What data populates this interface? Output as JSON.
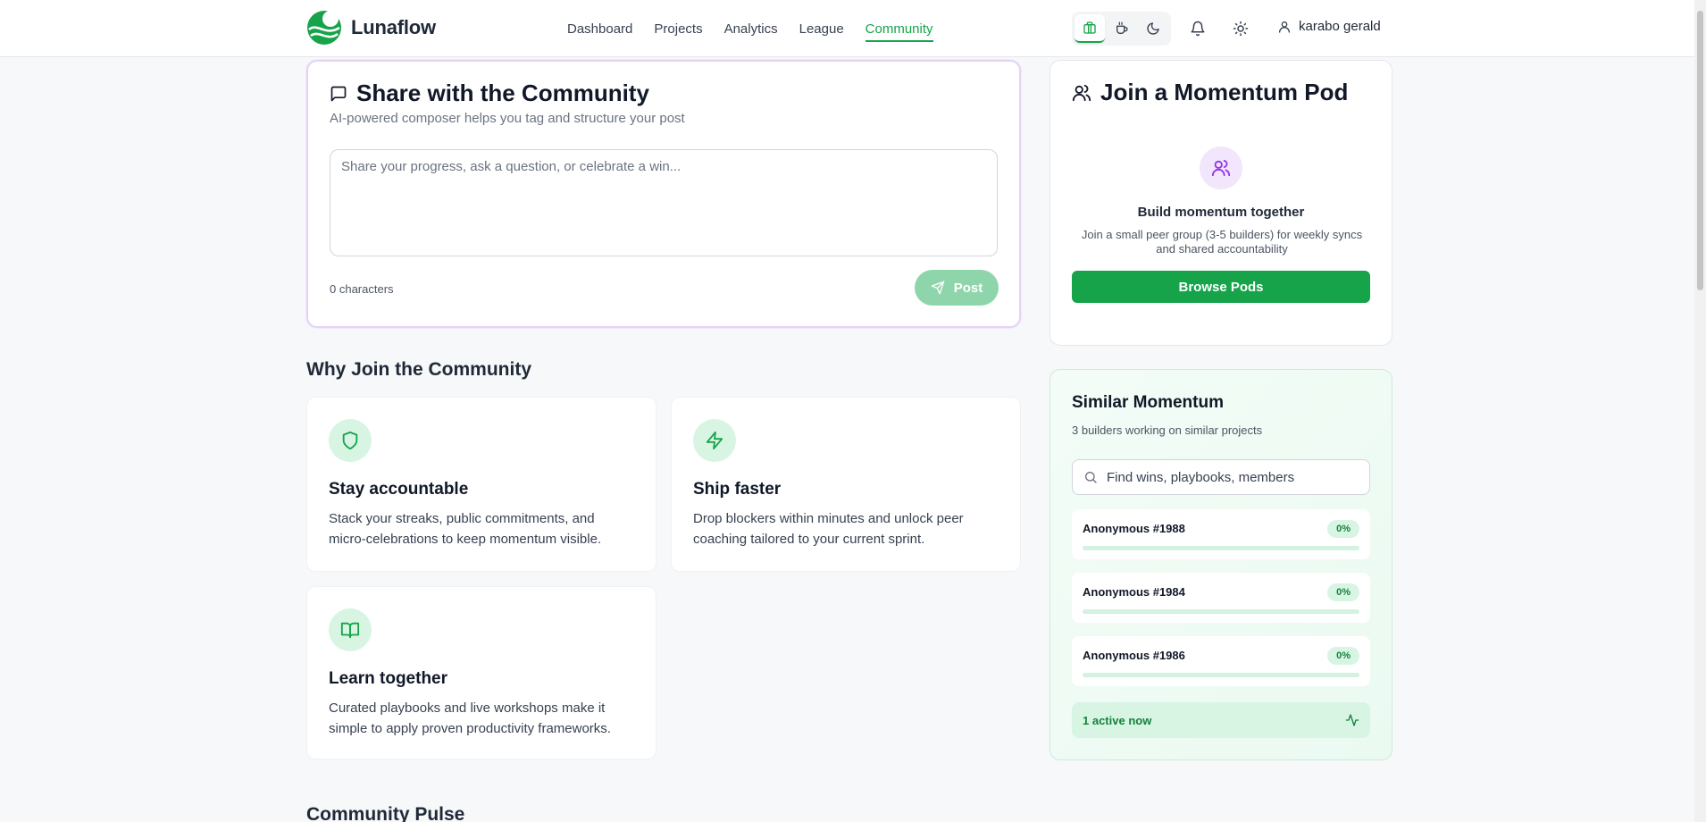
{
  "app": {
    "name": "Lunaflow"
  },
  "nav": {
    "items": [
      {
        "label": "Dashboard",
        "active": false
      },
      {
        "label": "Projects",
        "active": false
      },
      {
        "label": "Analytics",
        "active": false
      },
      {
        "label": "League",
        "active": false
      },
      {
        "label": "Community",
        "active": true
      }
    ]
  },
  "header": {
    "mode_icons": [
      "briefcase-icon",
      "coffee-icon",
      "moon-icon"
    ],
    "notification_icon": "bell-icon",
    "theme_icon": "sun-icon",
    "user_name": "karabo gerald"
  },
  "composer": {
    "title": "Share with the Community",
    "subtitle": "AI-powered composer helps you tag and structure your post",
    "placeholder": "Share your progress, ask a question, or celebrate a win...",
    "char_count": "0 characters",
    "post_label": "Post"
  },
  "why": {
    "title": "Why Join the Community",
    "features": [
      {
        "icon": "shield-icon",
        "title": "Stay accountable",
        "desc": "Stack your streaks, public commitments, and micro-celebrations to keep momentum visible."
      },
      {
        "icon": "zap-icon",
        "title": "Ship faster",
        "desc": "Drop blockers within minutes and unlock peer coaching tailored to your current sprint."
      },
      {
        "icon": "book-open-icon",
        "title": "Learn together",
        "desc": "Curated playbooks and live workshops make it simple to apply proven productivity frameworks."
      }
    ]
  },
  "pod": {
    "title": "Join a Momentum Pod",
    "heading": "Build momentum together",
    "desc": "Join a small peer group (3-5 builders) for weekly syncs and shared accountability",
    "button": "Browse Pods"
  },
  "similar": {
    "title": "Similar Momentum",
    "subtitle": "3 builders working on similar projects",
    "search_placeholder": "Find wins, playbooks, members",
    "members": [
      {
        "name": "Anonymous #1988",
        "progress_label": "0%",
        "progress": 0
      },
      {
        "name": "Anonymous #1984",
        "progress_label": "0%",
        "progress": 0
      },
      {
        "name": "Anonymous #1986",
        "progress_label": "0%",
        "progress": 0
      }
    ],
    "active_now": "1 active now"
  },
  "pulse": {
    "title": "Community Pulse"
  },
  "colors": {
    "accent": "#16a34a",
    "accent_light": "#d8f5e3",
    "purple": "#9333ea"
  }
}
